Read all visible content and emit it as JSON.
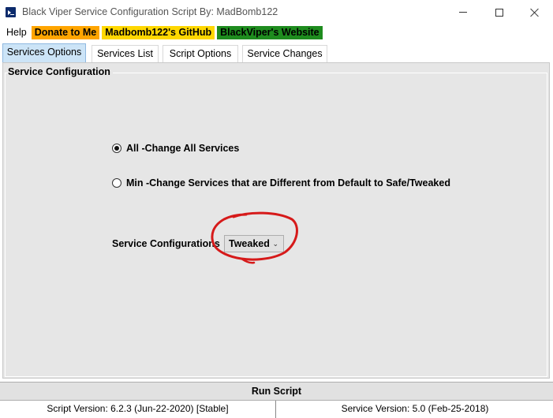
{
  "window": {
    "title": "Black Viper Service Configuration Script By: MadBomb122"
  },
  "menu": {
    "help": "Help",
    "donate": "Donate to Me",
    "github": "Madbomb122's GitHub",
    "website": "BlackViper's Website",
    "colors": {
      "donate": "#ffa500",
      "github": "#ffd700",
      "website": "#1e8c1e"
    }
  },
  "tabs": [
    {
      "label": "Services Options",
      "active": true
    },
    {
      "label": "Services List",
      "active": false
    },
    {
      "label": "Script Options",
      "active": false
    },
    {
      "label": "Service Changes",
      "active": false
    }
  ],
  "panel": {
    "group_title": "Service Configuration",
    "radio_all": {
      "label": "All -Change All Services",
      "checked": true
    },
    "radio_min": {
      "label": "Min -Change Services that are Different from Default to Safe/Tweaked",
      "checked": false
    },
    "service_config_label": "Service Configurations",
    "service_config_value": "Tweaked"
  },
  "run_button": "Run Script",
  "status": {
    "script_version": "Script Version: 6.2.3 (Jun-22-2020) [Stable]",
    "service_version": "Service Version: 5.0 (Feb-25-2018)"
  },
  "annotation_color": "#d61a1a"
}
